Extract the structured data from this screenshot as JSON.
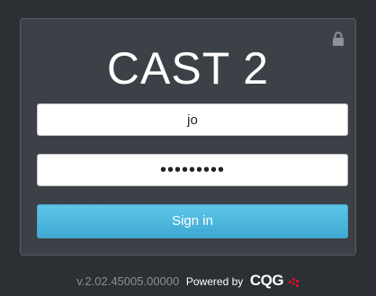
{
  "app": {
    "title": "CAST 2"
  },
  "login": {
    "username_value": "jo",
    "password_value": "•••••••••",
    "signin_label": "Sign in"
  },
  "icons": {
    "lock": "lock-icon",
    "brand_mark": "cqg-logo-mark"
  },
  "footer": {
    "version": "v.2.02.45005.00000",
    "powered_by": "Powered by",
    "brand": "CQG"
  },
  "colors": {
    "background": "#2c2f34",
    "panel": "#3c4047",
    "button": "#4fb8df",
    "brand_accent": "#c8102e"
  }
}
